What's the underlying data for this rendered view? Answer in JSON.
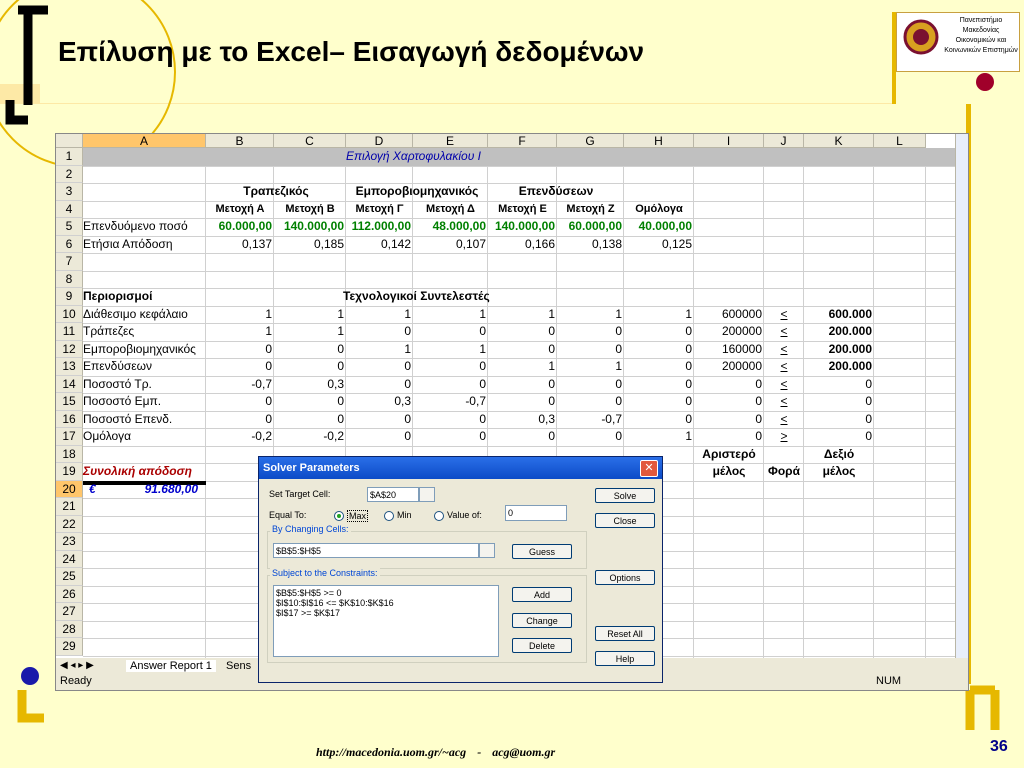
{
  "slide": {
    "title": "Επίλυση με το Excel– Εισαγωγή δεδομένων",
    "logo_text": "Πανεπιστήμιο Μακεδονίας Οικονομικών και Κοινωνικών Επιστημών",
    "footer_link1": "http://macedonia.uom.gr/~acg",
    "footer_sep": "-",
    "footer_link2": "acg@uom.gr",
    "page_number": "36",
    "accent": "#e6b800"
  },
  "sheet": {
    "columns": [
      "A",
      "B",
      "C",
      "D",
      "E",
      "F",
      "G",
      "H",
      "I",
      "J",
      "K",
      "L"
    ],
    "rows": [
      "1",
      "2",
      "3",
      "4",
      "5",
      "6",
      "7",
      "8",
      "9",
      "10",
      "11",
      "12",
      "13",
      "14",
      "15",
      "16",
      "17",
      "18",
      "19",
      "20",
      "21",
      "22",
      "23",
      "24",
      "25",
      "26",
      "27",
      "28",
      "29"
    ],
    "banner": "Επιλογή  Χαρτοφυλακίου   Ι",
    "r3": {
      "b_c": "Τραπεζικός",
      "d_e": "Εμπορoβιομηχανικός",
      "f_g": "Επενδύσεων"
    },
    "r4": [
      "Μετοχή Α",
      "Μετοχή Β",
      "Μετοχή Γ",
      "Μετοχή Δ",
      "Μετοχή Ε",
      "Μετοχή Ζ",
      "Ομόλογα"
    ],
    "r5": {
      "label": "Επενδυόμενο ποσό",
      "values": [
        "60.000,00",
        "140.000,00",
        "112.000,00",
        "48.000,00",
        "140.000,00",
        "60.000,00",
        "40.000,00"
      ]
    },
    "r6": {
      "label": "Ετήσια Απόδοση",
      "values": [
        "0,137",
        "0,185",
        "0,142",
        "0,107",
        "0,166",
        "0,138",
        "0,125"
      ]
    },
    "r9": {
      "label": "Περιορισμοί",
      "center": "Τεχνολογικοί  Συντελεστές"
    },
    "constraints": [
      {
        "label": "Διάθεσιμο κεφάλαιο",
        "v": [
          "1",
          "1",
          "1",
          "1",
          "1",
          "1",
          "1"
        ],
        "i": "600000",
        "j": "<",
        "k": "600.000"
      },
      {
        "label": "Τράπεζες",
        "v": [
          "1",
          "1",
          "0",
          "0",
          "0",
          "0",
          "0"
        ],
        "i": "200000",
        "j": "<",
        "k": "200.000"
      },
      {
        "label": "Εμπορoβιομηχανικός",
        "v": [
          "0",
          "0",
          "1",
          "1",
          "0",
          "0",
          "0"
        ],
        "i": "160000",
        "j": "<",
        "k": "200.000"
      },
      {
        "label": " Επενδύσεων",
        "v": [
          "0",
          "0",
          "0",
          "0",
          "1",
          "1",
          "0"
        ],
        "i": "200000",
        "j": "<",
        "k": "200.000"
      },
      {
        "label": "Ποσοστό Τρ.",
        "v": [
          "-0,7",
          "0,3",
          "0",
          "0",
          "0",
          "0",
          "0"
        ],
        "i": "0",
        "j": "<",
        "k": "0"
      },
      {
        "label": "Ποσοστό Εμπ.",
        "v": [
          "0",
          "0",
          "0,3",
          "-0,7",
          "0",
          "0",
          "0"
        ],
        "i": "0",
        "j": "<",
        "k": "0"
      },
      {
        "label": "Ποσοστό Επενδ.",
        "v": [
          "0",
          "0",
          "0",
          "0",
          "0,3",
          "-0,7",
          "0"
        ],
        "i": "0",
        "j": "<",
        "k": "0"
      },
      {
        "label": "Ομόλογα",
        "v": [
          "-0,2",
          "-0,2",
          "0",
          "0",
          "0",
          "0",
          "1"
        ],
        "i": "0",
        "j": ">",
        "k": "0"
      }
    ],
    "r18": {
      "i": "Αριστερό",
      "k": "Δεξιό"
    },
    "r19": {
      "a": "Συνολική απόδοση",
      "i": "μέλος",
      "j": "Φορά",
      "k": "μέλος"
    },
    "r20": {
      "currency": "€",
      "value": "91.680,00"
    },
    "tabs": [
      "Answer Report 1",
      "Sens"
    ],
    "status": "Ready",
    "num": "NUM"
  },
  "solver": {
    "title": "Solver Parameters",
    "target_label": "Set Target Cell:",
    "target_value": "$A$20",
    "equal_to": "Equal To:",
    "max": "Max",
    "min": "Min",
    "value_of": "Value of:",
    "value_of_value": "0",
    "changing_label": "By Changing Cells:",
    "changing_value": "$B$5:$H$5",
    "constraints_label": "Subject to the Constraints:",
    "constraints": [
      "$B$5:$H$5 >= 0",
      "$I$10:$I$16 <= $K$10:$K$16",
      "$I$17 >= $K$17"
    ],
    "buttons": {
      "solve": "Solve",
      "close": "Close",
      "guess": "Guess",
      "options": "Options",
      "add": "Add",
      "change": "Change",
      "delete": "Delete",
      "reset": "Reset All",
      "help": "Help"
    }
  }
}
